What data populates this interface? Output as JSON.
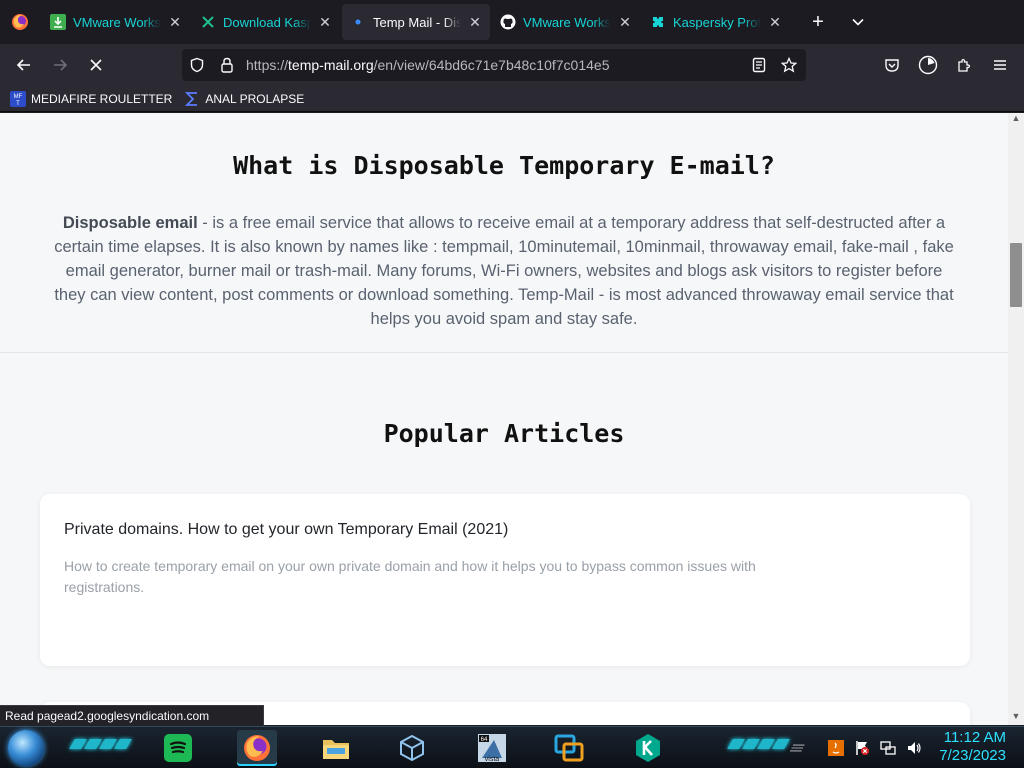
{
  "browser": {
    "tabs": [
      {
        "label": "VMware Workstation",
        "icon": "download-icon",
        "active": false
      },
      {
        "label": "Download Kaspersky",
        "icon": "kaspersky-icon",
        "active": false
      },
      {
        "label": "Temp Mail - Disposable",
        "icon": "loading-dot-icon",
        "active": true
      },
      {
        "label": "VMware Workstation",
        "icon": "github-icon",
        "active": false
      },
      {
        "label": "Kaspersky Protect",
        "icon": "kaspersky-puzzle-icon",
        "active": false
      }
    ],
    "close_glyph": "✕",
    "new_tab_glyph": "+",
    "url": {
      "scheme": "https://",
      "host": "temp-mail.org",
      "path": "/en/view/64bd6c71e7b48c10f7c014e5"
    },
    "bookmarks": [
      {
        "label": "MEDIAFIRE ROULETTER",
        "icon": "mediafire-icon"
      },
      {
        "label": "ANAL PROLAPSE",
        "icon": "sigma-icon"
      }
    ],
    "status_text": "Read pagead2.googlesyndication.com"
  },
  "page": {
    "disposable_heading": "What is Disposable Temporary E-mail?",
    "intro_bold": "Disposable email",
    "intro_text": " - is a free email service that allows to receive email at a temporary address that self-destructed after a certain time elapses. It is also known by names like : tempmail, 10minutemail, 10minmail, throwaway email, fake-mail , fake email generator, burner mail or trash-mail. Many forums, Wi-Fi owners, websites and blogs ask visitors to register before they can view content, post comments or download something. Temp-Mail - is most advanced throwaway email service that helps you avoid spam and stay safe.",
    "popular_heading": "Popular Articles",
    "articles": [
      {
        "title": "Private domains. How to get your own Temporary Email (2021)",
        "description": "How to create temporary email on your own private domain and how it helps you to bypass common issues with registrations."
      }
    ]
  },
  "taskbar": {
    "time": "11:12 AM",
    "date": "7/23/2023",
    "vista_badge": "64",
    "vista_label": "vista"
  },
  "colors": {
    "tab_text": "#17d4d4",
    "chrome_bg": "#1c1b22",
    "toolbar_bg": "#2b2a33",
    "page_bg": "#f6f7f8",
    "clock": "#2ee0ff"
  }
}
